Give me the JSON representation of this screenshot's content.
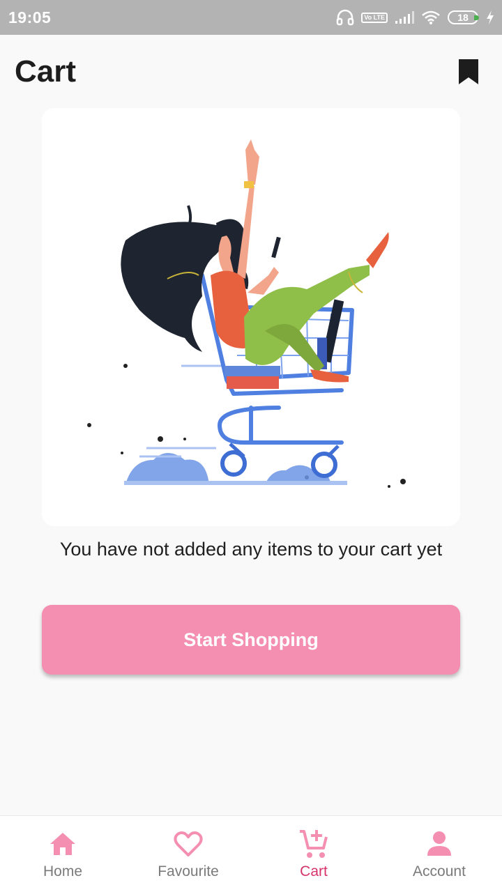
{
  "status_bar": {
    "time": "19:05",
    "network_badge": "Vo LTE",
    "battery_level": "18",
    "icons": [
      "headphones-icon",
      "volte-icon",
      "signal-icon",
      "wifi-icon",
      "battery-icon",
      "charging-icon"
    ]
  },
  "header": {
    "title": "Cart",
    "bookmark_icon": "bookmark-icon"
  },
  "empty_state": {
    "message": "You have not added any items to your cart yet",
    "button_label": "Start Shopping"
  },
  "bottom_nav": {
    "items": [
      {
        "label": "Home",
        "icon": "home-icon",
        "active": false
      },
      {
        "label": "Favourite",
        "icon": "heart-icon",
        "active": false
      },
      {
        "label": "Cart",
        "icon": "cart-plus-icon",
        "active": true
      },
      {
        "label": "Account",
        "icon": "person-icon",
        "active": false
      }
    ]
  },
  "colors": {
    "accent": "#f48fb1",
    "active_nav": "#d6336c",
    "status_bar": "#b3b3b3",
    "background": "#f9f9f9"
  }
}
